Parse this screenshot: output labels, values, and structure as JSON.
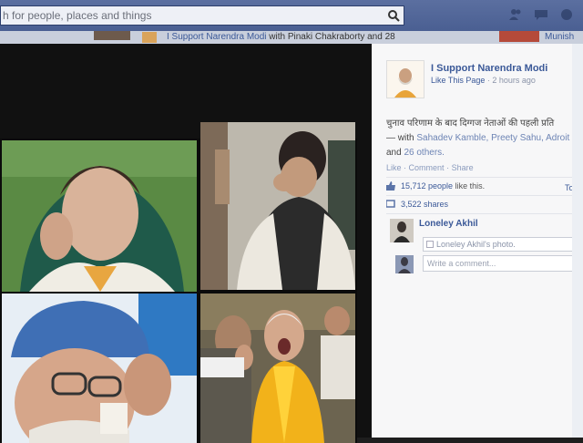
{
  "search": {
    "value": "h for people, places and things"
  },
  "feed": {
    "story_page": "I Support Narendra Modi",
    "story_with": "with Pinaki Chakraborty and 28",
    "story_more": "Munish"
  },
  "post": {
    "page_name": "I Support Narendra Modi",
    "like_page": "Like This Page",
    "time": "2 hours ago",
    "caption_text": "चुनाव परिणाम के बाद दिग्गज नेताओं की पहली प्रति",
    "with_text": "— with",
    "tagged": "Sahadev Kamble, Preety Sahu, Adroit",
    "and": "and",
    "others": "26 others.",
    "actions": {
      "like": "Like",
      "comment": "Comment",
      "share": "Share",
      "sep": "·"
    },
    "likes_count": "15,712 people",
    "likes_suffix": "like this.",
    "top_comments": "Top C",
    "shares": "3,522 shares"
  },
  "comment": {
    "author": "Loneley Akhil",
    "attachment": "Loneley Akhil's photo."
  },
  "composer": {
    "placeholder": "Write a comment..."
  },
  "colors": {
    "fb_blue": "#3b5998",
    "topbar": "#4a5f92"
  }
}
